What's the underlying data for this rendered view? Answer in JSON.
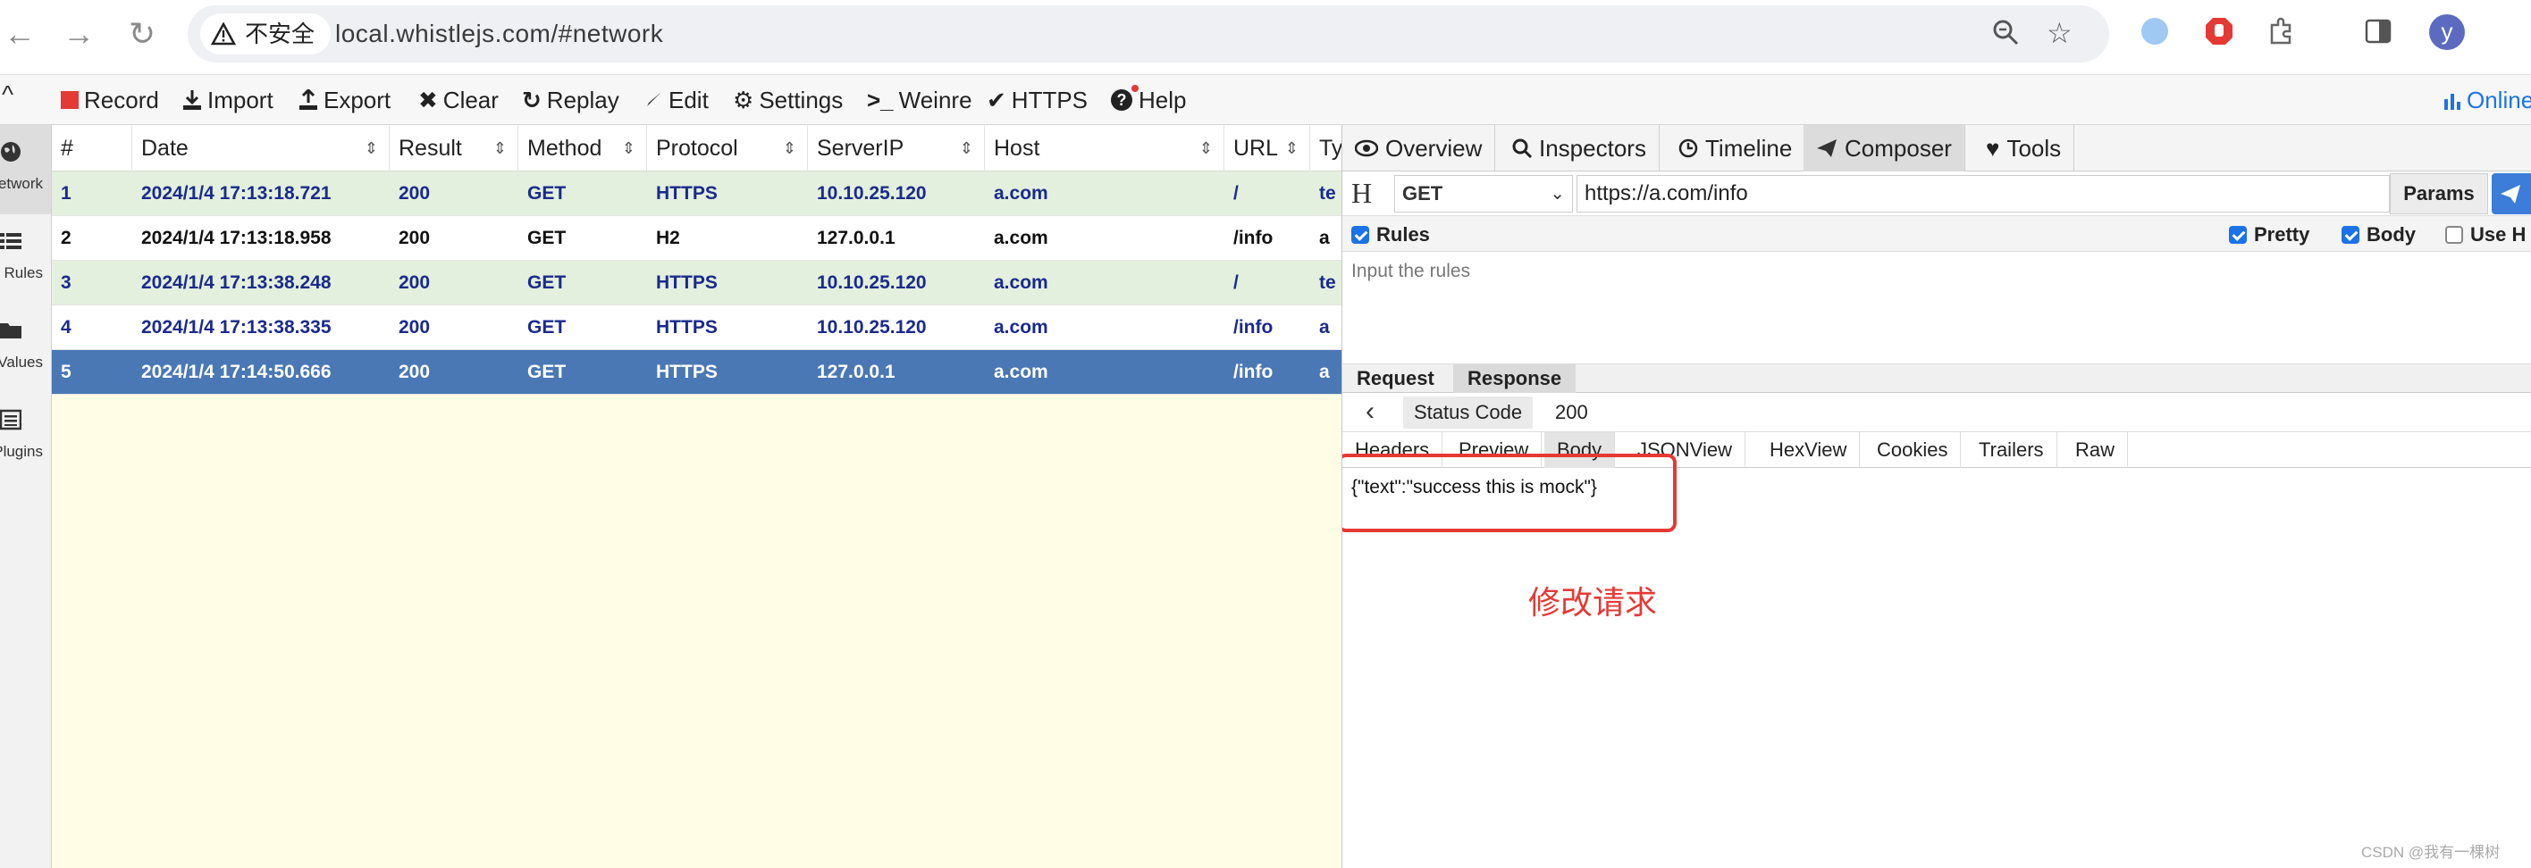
{
  "browser": {
    "security_label": "不安全",
    "url": "local.whistlejs.com/#network",
    "avatar_letter": "y"
  },
  "toolbar": {
    "record": "Record",
    "import": "Import",
    "export": "Export",
    "clear": "Clear",
    "replay": "Replay",
    "edit": "Edit",
    "settings": "Settings",
    "weinre": "Weinre",
    "https": "HTTPS",
    "help": "Help",
    "online": "Online",
    "record_color": "#e53935"
  },
  "sidebar": {
    "items": [
      {
        "label": "Network",
        "icon": "globe-icon"
      },
      {
        "label": "Rules",
        "icon": "list-icon"
      },
      {
        "label": "Values",
        "icon": "folder-icon"
      },
      {
        "label": "Plugins",
        "icon": "plugins-icon"
      }
    ]
  },
  "table": {
    "columns": [
      "#",
      "Date",
      "Result",
      "Method",
      "Protocol",
      "ServerIP",
      "Host",
      "URL",
      "Ty"
    ],
    "rows": [
      {
        "n": "1",
        "date": "2024/1/4 17:13:18.721",
        "result": "200",
        "method": "GET",
        "protocol": "HTTPS",
        "ip": "10.10.25.120",
        "host": "a.com",
        "url": "/",
        "type": "te"
      },
      {
        "n": "2",
        "date": "2024/1/4 17:13:18.958",
        "result": "200",
        "method": "GET",
        "protocol": "H2",
        "ip": "127.0.0.1",
        "host": "a.com",
        "url": "/info",
        "type": "a"
      },
      {
        "n": "3",
        "date": "2024/1/4 17:13:38.248",
        "result": "200",
        "method": "GET",
        "protocol": "HTTPS",
        "ip": "10.10.25.120",
        "host": "a.com",
        "url": "/",
        "type": "te"
      },
      {
        "n": "4",
        "date": "2024/1/4 17:13:38.335",
        "result": "200",
        "method": "GET",
        "protocol": "HTTPS",
        "ip": "10.10.25.120",
        "host": "a.com",
        "url": "/info",
        "type": "a"
      },
      {
        "n": "5",
        "date": "2024/1/4 17:14:50.666",
        "result": "200",
        "method": "GET",
        "protocol": "HTTPS",
        "ip": "127.0.0.1",
        "host": "a.com",
        "url": "/info",
        "type": "a"
      }
    ]
  },
  "detail": {
    "tabs": [
      "Overview",
      "Inspectors",
      "Timeline",
      "Composer",
      "Tools"
    ],
    "composer": {
      "h_label": "H",
      "method": "GET",
      "url": "https://a.com/info",
      "params": "Params",
      "rules_label": "Rules",
      "pretty_label": "Pretty",
      "body_label": "Body",
      "use_label": "Use H",
      "rules_placeholder": "Input the rules"
    },
    "req_res_tabs": [
      "Request",
      "Response"
    ],
    "status_label": "Status Code",
    "status_value": "200",
    "body_tabs": [
      "Headers",
      "Preview",
      "Body",
      "JSONView",
      "HexView",
      "Cookies",
      "Trailers",
      "Raw"
    ],
    "body_text": "{\"text\":\"success this is mock\"}",
    "annotation": "修改请求"
  },
  "watermark": "CSDN @我有一棵树"
}
